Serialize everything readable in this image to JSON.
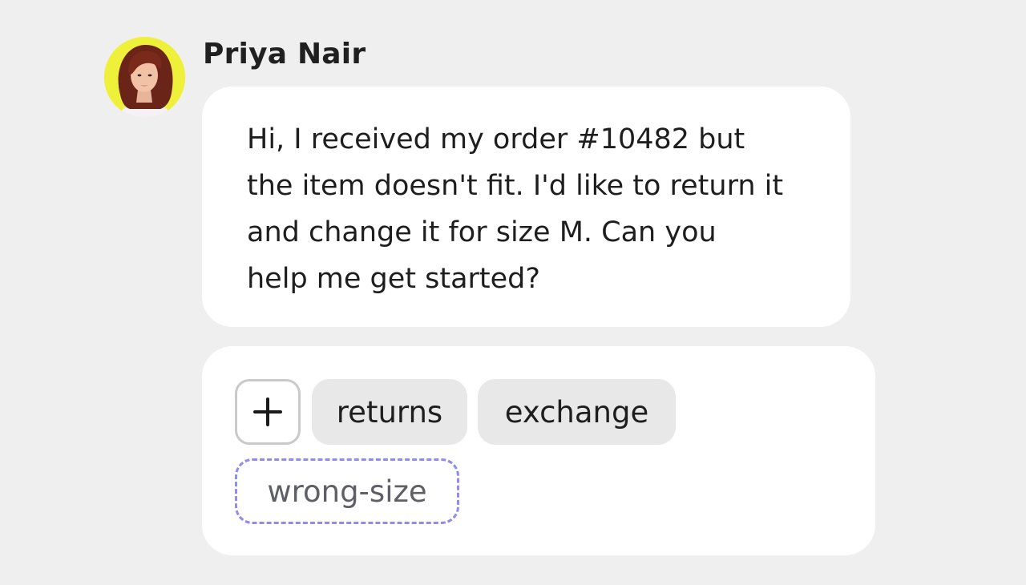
{
  "sender": {
    "name": "Priya Nair",
    "avatar_icon": "user-avatar-photo",
    "avatar_ring_color": "#eef03a"
  },
  "message": {
    "text": "Hi, I received my order #10482 but\nthe item doesn't fit. I'd like to return it\nand change it for size M. Can you\nhelp me get started?"
  },
  "tags": {
    "add_icon": "plus-icon",
    "items": [
      {
        "label": "returns"
      },
      {
        "label": "exchange"
      }
    ],
    "suggested": {
      "label": "wrong-size"
    },
    "suggested_border_color": "#8f8cf0"
  }
}
